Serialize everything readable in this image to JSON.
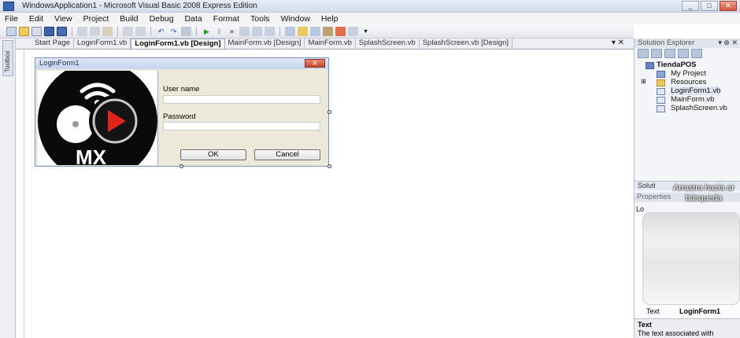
{
  "window": {
    "title": "WindowsApplication1 - Microsoft Visual Basic 2008 Express Edition",
    "minimize_glyph": "_",
    "maximize_glyph": "□",
    "close_glyph": "✕"
  },
  "menu": [
    "File",
    "Edit",
    "View",
    "Project",
    "Build",
    "Debug",
    "Data",
    "Format",
    "Tools",
    "Window",
    "Help"
  ],
  "toolbox": {
    "label": "Toolbox"
  },
  "document_tabs": {
    "tabs": [
      "Start Page",
      "LoginForm1.vb",
      "LoginForm1.vb [Design]",
      "MainForm.vb [Design]",
      "MainForm.vb",
      "SplashScreen.vb",
      "SplashScreen.vb [Design]"
    ],
    "active_index": 2,
    "controls": "▾ ✕"
  },
  "login_form": {
    "title": "LoginForm1",
    "close_glyph": "✕",
    "username_label": "User name",
    "password_label": "Password",
    "ok_label": "OK",
    "cancel_label": "Cancel",
    "logo_text": "MX"
  },
  "solution_explorer": {
    "title": "Solution Explorer",
    "controls": "▾ ⊕ ✕",
    "items": [
      {
        "label": "TiendaPOS",
        "icon": "solution-project-icon"
      },
      {
        "label": "My Project",
        "icon": "my-project-icon"
      },
      {
        "label": "Resources",
        "icon": "folder-icon"
      },
      {
        "label": "LoginForm1.vb",
        "icon": "form-file-icon"
      },
      {
        "label": "MainForm.vb",
        "icon": "form-file-icon"
      },
      {
        "label": "SplashScreen.vb",
        "icon": "form-file-icon"
      }
    ],
    "bottom_tab": "Soluti"
  },
  "overlay": {
    "line1": "Arrastra hacia ar",
    "line2": "búsqueda"
  },
  "properties": {
    "title": "Properties",
    "combo_value": "Lo",
    "row_label": "Text",
    "row_value": "LoginForm1",
    "desc_title": "Text",
    "desc_text": "The text associated with"
  },
  "colors": {
    "accent": "#3a66b0",
    "logo_bg": "#0a0a0a",
    "play_red": "#e02418"
  }
}
